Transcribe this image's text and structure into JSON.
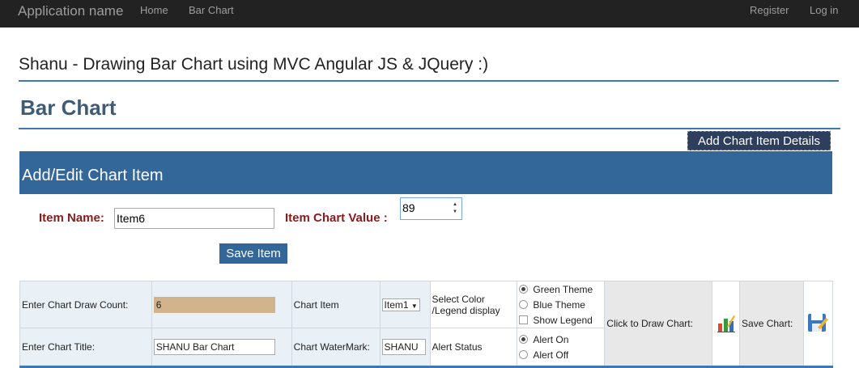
{
  "navbar": {
    "brand": "Application name",
    "links": [
      "Home",
      "Bar Chart"
    ],
    "right_links": [
      "Register",
      "Log in"
    ]
  },
  "page": {
    "site_title": "Shanu - Drawing Bar Chart using MVC Angular JS & JQuery :)",
    "section_title": "Bar Chart",
    "add_button": "Add Chart Item Details"
  },
  "form": {
    "panel_title": "Add/Edit Chart Item",
    "item_name_label": "Item Name:",
    "item_name_value": "Item6",
    "item_value_label": "Item Chart Value :",
    "item_value_value": "89",
    "save_button": "Save Item"
  },
  "config": {
    "draw_count_label": "Enter Chart Draw Count:",
    "draw_count_value": "6",
    "chart_item_label": "Chart Item",
    "chart_item_select": "Item1",
    "select_color_label": "Select Color /Legend display",
    "green_theme": "Green Theme",
    "blue_theme": "Blue Theme",
    "show_legend": "Show Legend",
    "draw_label": "Click to Draw Chart:",
    "save_label": "Save Chart:",
    "title_label": "Enter Chart Title:",
    "title_value": "SHANU Bar Chart",
    "watermark_label": "Chart WaterMark:",
    "watermark_value": "SHANU",
    "alert_label": "Alert Status",
    "alert_on": "Alert On",
    "alert_off": "Alert Off"
  },
  "colors": {
    "navbar_bg": "#222222",
    "panel_blue": "#336699",
    "draw_count_fill": "#d2b48c"
  },
  "icons": [
    "bar-chart-icon",
    "save-disk-icon",
    "chevron-down-icon"
  ]
}
